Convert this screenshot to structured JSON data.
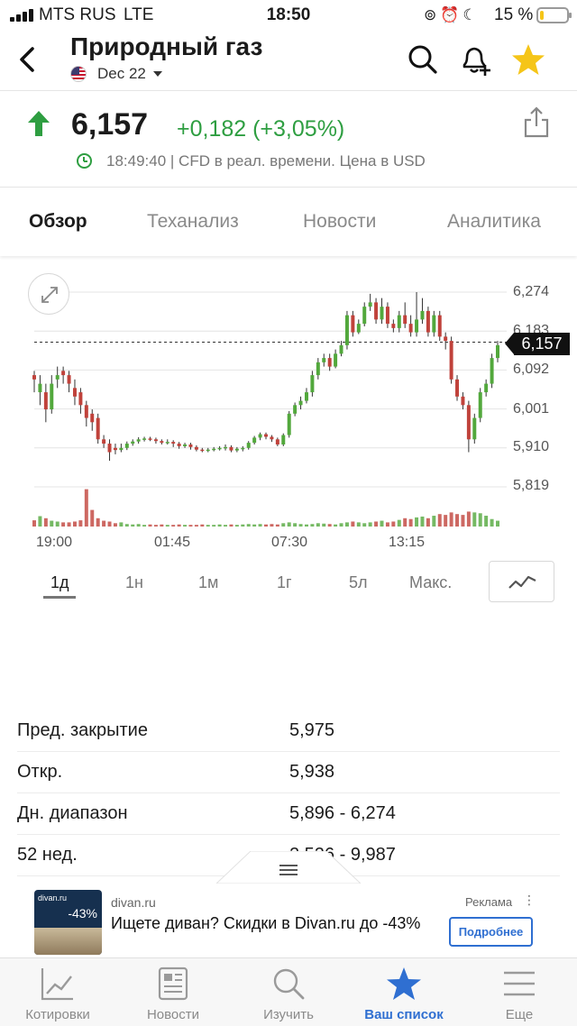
{
  "status_bar": {
    "carrier": "MTS RUS",
    "network": "LTE",
    "time": "18:50",
    "battery_pct": "15 %",
    "battery_level": 0.15
  },
  "header": {
    "title": "Природный газ",
    "contract": "Dec 22"
  },
  "quote": {
    "price": "6,157",
    "change": "+0,182 (+3,05%)",
    "timestamp": "18:49:40 | CFD в реал. времени. Цена в USD",
    "up_color": "#2e9e41"
  },
  "tabs": [
    "Обзор",
    "Теханализ",
    "Новости",
    "Аналитика"
  ],
  "chart": {
    "current_price_label": "6,157",
    "y_ticks": [
      "6,274",
      "6,183",
      "6,092",
      "6,001",
      "5,910",
      "5,819"
    ],
    "x_ticks": [
      "19:00",
      "01:45",
      "07:30",
      "13:15"
    ]
  },
  "chart_data": {
    "type": "candlestick",
    "ylim": [
      5.819,
      6.274
    ],
    "current_price": 6.157,
    "candles": [
      [
        6.08,
        6.07,
        6.09,
        6.04
      ],
      [
        6.04,
        6.06,
        6.08,
        6.01
      ],
      [
        6.04,
        6.0,
        6.06,
        5.97
      ],
      [
        6.0,
        6.06,
        6.08,
        5.99
      ],
      [
        6.07,
        6.08,
        6.1,
        6.05
      ],
      [
        6.09,
        6.08,
        6.1,
        6.06
      ],
      [
        6.08,
        6.06,
        6.09,
        6.04
      ],
      [
        6.05,
        6.03,
        6.07,
        6.01
      ],
      [
        6.04,
        6.01,
        6.05,
        5.99
      ],
      [
        6.01,
        5.98,
        6.02,
        5.96
      ],
      [
        5.99,
        5.97,
        6.0,
        5.95
      ],
      [
        5.98,
        5.93,
        5.99,
        5.92
      ],
      [
        5.93,
        5.92,
        5.94,
        5.91
      ],
      [
        5.92,
        5.9,
        5.93,
        5.88
      ],
      [
        5.91,
        5.905,
        5.92,
        5.895
      ],
      [
        5.905,
        5.91,
        5.92,
        5.9
      ],
      [
        5.91,
        5.92,
        5.925,
        5.905
      ],
      [
        5.92,
        5.925,
        5.93,
        5.915
      ],
      [
        5.925,
        5.93,
        5.935,
        5.92
      ],
      [
        5.93,
        5.932,
        5.936,
        5.925
      ],
      [
        5.932,
        5.93,
        5.936,
        5.926
      ],
      [
        5.93,
        5.926,
        5.934,
        5.92
      ],
      [
        5.926,
        5.922,
        5.93,
        5.918
      ],
      [
        5.922,
        5.924,
        5.93,
        5.918
      ],
      [
        5.924,
        5.92,
        5.928,
        5.912
      ],
      [
        5.92,
        5.914,
        5.924,
        5.908
      ],
      [
        5.914,
        5.918,
        5.922,
        5.91
      ],
      [
        5.918,
        5.912,
        5.922,
        5.906
      ],
      [
        5.912,
        5.906,
        5.916,
        5.902
      ],
      [
        5.906,
        5.904,
        5.91,
        5.9
      ],
      [
        5.904,
        5.906,
        5.91,
        5.9
      ],
      [
        5.906,
        5.908,
        5.912,
        5.902
      ],
      [
        5.908,
        5.91,
        5.914,
        5.904
      ],
      [
        5.91,
        5.912,
        5.918,
        5.904
      ],
      [
        5.912,
        5.904,
        5.916,
        5.9
      ],
      [
        5.904,
        5.908,
        5.912,
        5.9
      ],
      [
        5.908,
        5.91,
        5.914,
        5.902
      ],
      [
        5.91,
        5.922,
        5.926,
        5.906
      ],
      [
        5.922,
        5.934,
        5.938,
        5.918
      ],
      [
        5.934,
        5.942,
        5.946,
        5.928
      ],
      [
        5.942,
        5.936,
        5.946,
        5.93
      ],
      [
        5.936,
        5.93,
        5.94,
        5.924
      ],
      [
        5.93,
        5.918,
        5.934,
        5.914
      ],
      [
        5.918,
        5.94,
        5.944,
        5.914
      ],
      [
        5.94,
        5.99,
        5.996,
        5.934
      ],
      [
        5.99,
        6.01,
        6.016,
        5.984
      ],
      [
        6.01,
        6.02,
        6.03,
        6.0
      ],
      [
        6.02,
        6.04,
        6.05,
        6.014
      ],
      [
        6.04,
        6.08,
        6.09,
        6.03
      ],
      [
        6.08,
        6.11,
        6.12,
        6.07
      ],
      [
        6.11,
        6.12,
        6.13,
        6.1
      ],
      [
        6.12,
        6.1,
        6.13,
        6.09
      ],
      [
        6.1,
        6.13,
        6.14,
        6.096
      ],
      [
        6.13,
        6.15,
        6.16,
        6.124
      ],
      [
        6.15,
        6.22,
        6.23,
        6.14
      ],
      [
        6.22,
        6.18,
        6.23,
        6.17
      ],
      [
        6.18,
        6.2,
        6.21,
        6.176
      ],
      [
        6.2,
        6.24,
        6.25,
        6.194
      ],
      [
        6.24,
        6.25,
        6.27,
        6.23
      ],
      [
        6.25,
        6.21,
        6.26,
        6.2
      ],
      [
        6.21,
        6.24,
        6.26,
        6.2
      ],
      [
        6.24,
        6.2,
        6.25,
        6.19
      ],
      [
        6.2,
        6.19,
        6.21,
        6.18
      ],
      [
        6.19,
        6.22,
        6.23,
        6.18
      ],
      [
        6.22,
        6.2,
        6.25,
        6.19
      ],
      [
        6.2,
        6.18,
        6.22,
        6.17
      ],
      [
        6.18,
        6.21,
        6.274,
        6.17
      ],
      [
        6.21,
        6.23,
        6.26,
        6.2
      ],
      [
        6.23,
        6.18,
        6.24,
        6.17
      ],
      [
        6.18,
        6.22,
        6.23,
        6.17
      ],
      [
        6.22,
        6.17,
        6.23,
        6.16
      ],
      [
        6.17,
        6.16,
        6.18,
        6.14
      ],
      [
        6.16,
        6.07,
        6.17,
        6.06
      ],
      [
        6.07,
        6.03,
        6.08,
        6.02
      ],
      [
        6.03,
        6.01,
        6.04,
        6.0
      ],
      [
        6.01,
        5.93,
        6.02,
        5.9
      ],
      [
        5.93,
        5.98,
        5.99,
        5.92
      ],
      [
        5.98,
        6.04,
        6.05,
        5.97
      ],
      [
        6.04,
        6.06,
        6.07,
        6.03
      ],
      [
        6.06,
        6.12,
        6.13,
        6.05
      ],
      [
        6.12,
        6.15,
        6.16,
        6.11
      ]
    ],
    "volume": [
      0.15,
      0.25,
      0.2,
      0.14,
      0.12,
      0.1,
      0.1,
      0.12,
      0.15,
      0.9,
      0.4,
      0.2,
      0.14,
      0.12,
      0.08,
      0.1,
      0.06,
      0.05,
      0.06,
      0.04,
      0.05,
      0.04,
      0.05,
      0.04,
      0.04,
      0.05,
      0.04,
      0.04,
      0.04,
      0.05,
      0.04,
      0.04,
      0.05,
      0.04,
      0.05,
      0.04,
      0.05,
      0.06,
      0.05,
      0.06,
      0.05,
      0.06,
      0.05,
      0.08,
      0.1,
      0.08,
      0.06,
      0.05,
      0.06,
      0.08,
      0.07,
      0.06,
      0.05,
      0.08,
      0.1,
      0.12,
      0.1,
      0.08,
      0.1,
      0.12,
      0.14,
      0.1,
      0.12,
      0.16,
      0.2,
      0.18,
      0.22,
      0.24,
      0.2,
      0.26,
      0.3,
      0.28,
      0.34,
      0.3,
      0.28,
      0.36,
      0.34,
      0.32,
      0.26,
      0.18,
      0.14
    ],
    "up_color": "#52a83c",
    "down_color": "#c0423b",
    "x_tick_labels": [
      "19:00",
      "01:45",
      "07:30",
      "13:15"
    ]
  },
  "periods": [
    "1д",
    "1н",
    "1м",
    "1г",
    "5л",
    "Макс."
  ],
  "active_period": "1д",
  "stats": [
    {
      "label": "Пред. закрытие",
      "value": "5,975"
    },
    {
      "label": "Откр.",
      "value": "5,938"
    },
    {
      "label": "Дн. диапазон",
      "value": "5,896 - 6,274"
    },
    {
      "label": "52 нед.",
      "value": "2,526 - 9,987"
    }
  ],
  "ad": {
    "thumb_brand": "divan.ru",
    "thumb_discount": "-43%",
    "domain": "divan.ru",
    "label": "Реклама",
    "headline": "Ищете диван? Скидки в Divan.ru до -43%",
    "cta": "Подробнее"
  },
  "bottom_nav": [
    {
      "label": "Котировки",
      "icon": "chart-line-icon"
    },
    {
      "label": "Новости",
      "icon": "newspaper-icon"
    },
    {
      "label": "Изучить",
      "icon": "search-icon"
    },
    {
      "label": "Ваш список",
      "icon": "star-icon"
    },
    {
      "label": "Еще",
      "icon": "menu-icon"
    }
  ],
  "active_nav": "Ваш список",
  "colors": {
    "accent": "#2f6fd1",
    "star": "#f5c518",
    "positive": "#2e9e41"
  }
}
